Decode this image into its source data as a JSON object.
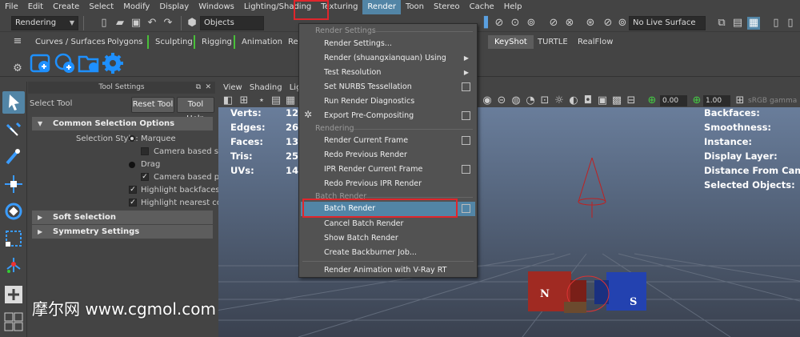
{
  "menubar": {
    "items": [
      "File",
      "Edit",
      "Create",
      "Select",
      "Modify",
      "Display",
      "Windows",
      "Lighting/Shading",
      "Texturing",
      "Render",
      "Toon",
      "Stereo",
      "Cache",
      "Help"
    ],
    "active": "Render"
  },
  "statusline": {
    "mode": "Rendering",
    "select_mask": "Objects",
    "live_surface": "No Live Surface"
  },
  "shelf": {
    "tabs": [
      "Curves / Surfaces",
      "Polygons",
      "Sculpting",
      "Rigging",
      "Animation",
      "Re",
      "KeyShot",
      "TURTLE",
      "RealFlow"
    ],
    "selected_tab": "KeyShot"
  },
  "tool_settings": {
    "header": "Tool Settings",
    "tool_name": "Select Tool",
    "reset_button": "Reset Tool",
    "help_button": "Tool Help",
    "common_section": "Common Selection Options",
    "selection_style_label": "Selection Style:",
    "marquee": "Marquee",
    "camera_based_selection": "Camera based sel",
    "drag": "Drag",
    "camera_based_paint": "Camera based pai",
    "highlight_backfaces": "Highlight backfaces",
    "highlight_nearest": "Highlight nearest com",
    "soft_selection": "Soft Selection",
    "symmetry_settings": "Symmetry Settings"
  },
  "viewport": {
    "menu": [
      "View",
      "Shading",
      "Light"
    ],
    "field_1": "0.00",
    "field_2": "1.00",
    "gamma": "sRGB gamma",
    "hud_left": [
      {
        "label": "Verts:",
        "value": "12"
      },
      {
        "label": "Edges:",
        "value": "26"
      },
      {
        "label": "Faces:",
        "value": "13"
      },
      {
        "label": "Tris:",
        "value": "25"
      },
      {
        "label": "UVs:",
        "value": "14"
      }
    ],
    "hud_right": [
      "Backfaces:",
      "Smoothness:",
      "Instance:",
      "Display Layer:",
      "Distance From Camera:",
      "Selected Objects:"
    ],
    "magnet_n": "N",
    "magnet_s": "S"
  },
  "render_menu": {
    "group_render_settings": "Render Settings",
    "render_settings": "Render Settings...",
    "render_using": "Render (shuangxianquan) Using",
    "test_resolution": "Test Resolution",
    "nurbs_tessellation": "Set NURBS Tessellation",
    "render_diagnostics": "Run Render Diagnostics",
    "export_precompositing": "Export Pre-Compositing",
    "group_rendering": "Rendering",
    "render_current_frame": "Render Current Frame",
    "redo_previous_render": "Redo Previous Render",
    "ipr_render_current_frame": "IPR Render Current Frame",
    "redo_previous_ipr": "Redo Previous IPR Render",
    "group_batch_render": "Batch Render",
    "batch_render": "Batch Render",
    "cancel_batch_render": "Cancel Batch Render",
    "show_batch_render": "Show Batch Render",
    "create_backburner": "Create Backburner Job...",
    "vray_rt": "Render Animation with V-Ray RT"
  },
  "watermark": "摩尔网 www.cgmol.com",
  "colors": {
    "highlight": "#5285a6",
    "annotation_red": "#e0262c",
    "shelf_tab_marker": "#49c039",
    "shelf_icon_blue": "#1e90ff"
  }
}
